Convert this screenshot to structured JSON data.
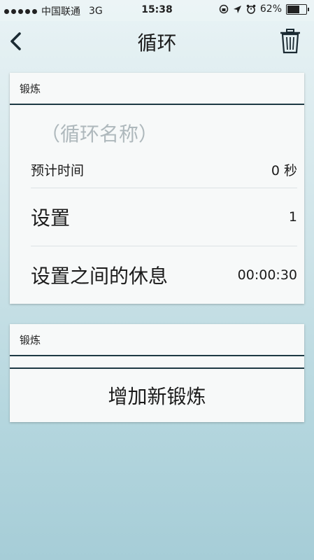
{
  "status": {
    "carrier": "中国联通",
    "network": "3G",
    "time": "15:38",
    "battery": "62%"
  },
  "nav": {
    "title": "循环",
    "back_icon": "chevron-left-icon",
    "trash_icon": "trash-icon"
  },
  "section1": {
    "header": "锻炼",
    "name_placeholder": "（循环名称）",
    "rows": [
      {
        "label": "预计时间",
        "value": "0 秒"
      },
      {
        "label": "设置",
        "value": "1"
      },
      {
        "label": "设置之间的休息",
        "value": "00:00:30"
      }
    ]
  },
  "section2": {
    "header": "锻炼",
    "add_label": "增加新锻炼"
  }
}
